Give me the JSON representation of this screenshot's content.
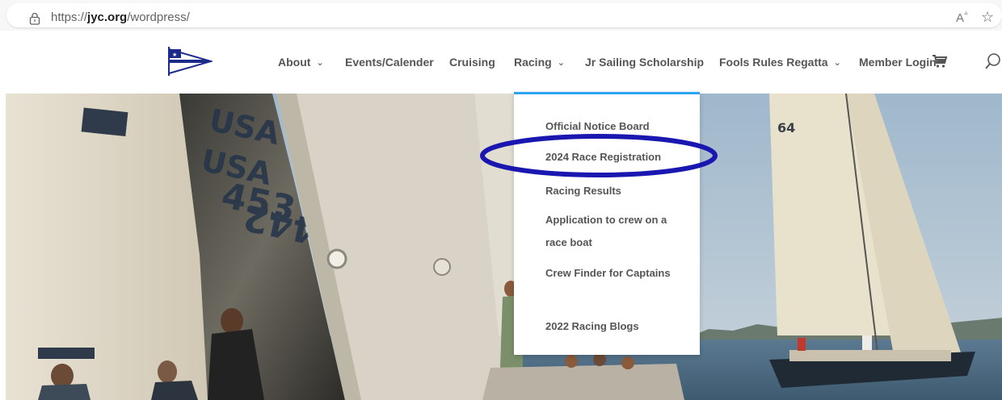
{
  "browser": {
    "url_scheme": "https://",
    "url_domain": "jyc.org",
    "url_path": "/wordpress/",
    "read_aloud_icon": "read-aloud-icon",
    "favorite_icon": "star-outline-icon"
  },
  "header": {
    "logo_icon": "burgee-flag-logo",
    "nav": [
      {
        "label": "About",
        "has_dropdown": true
      },
      {
        "label": "Events/Calender",
        "has_dropdown": false
      },
      {
        "label": "Cruising",
        "has_dropdown": false
      },
      {
        "label": "Racing",
        "has_dropdown": true
      },
      {
        "label": "Jr Sailing Scholarship",
        "has_dropdown": false
      },
      {
        "label": "Fools Rules Regatta",
        "has_dropdown": true
      },
      {
        "label": "Member Login",
        "has_dropdown": false
      }
    ],
    "cart_icon": "cart-icon",
    "search_icon": "search-icon"
  },
  "racing_menu": {
    "items": [
      {
        "label": "Official Notice Board"
      },
      {
        "label": "2024 Race Registration"
      },
      {
        "label": "Racing Results"
      },
      {
        "label": "Application to crew on a race boat"
      },
      {
        "label": "Crew Finder for Captains"
      },
      {
        "label": "2022 Racing Blogs"
      }
    ],
    "accent_color": "#2ea3f2",
    "highlight_color": "#1a17b0"
  },
  "hero": {
    "sail_markings": [
      "USA",
      "USA",
      "453",
      "442",
      "64"
    ]
  }
}
